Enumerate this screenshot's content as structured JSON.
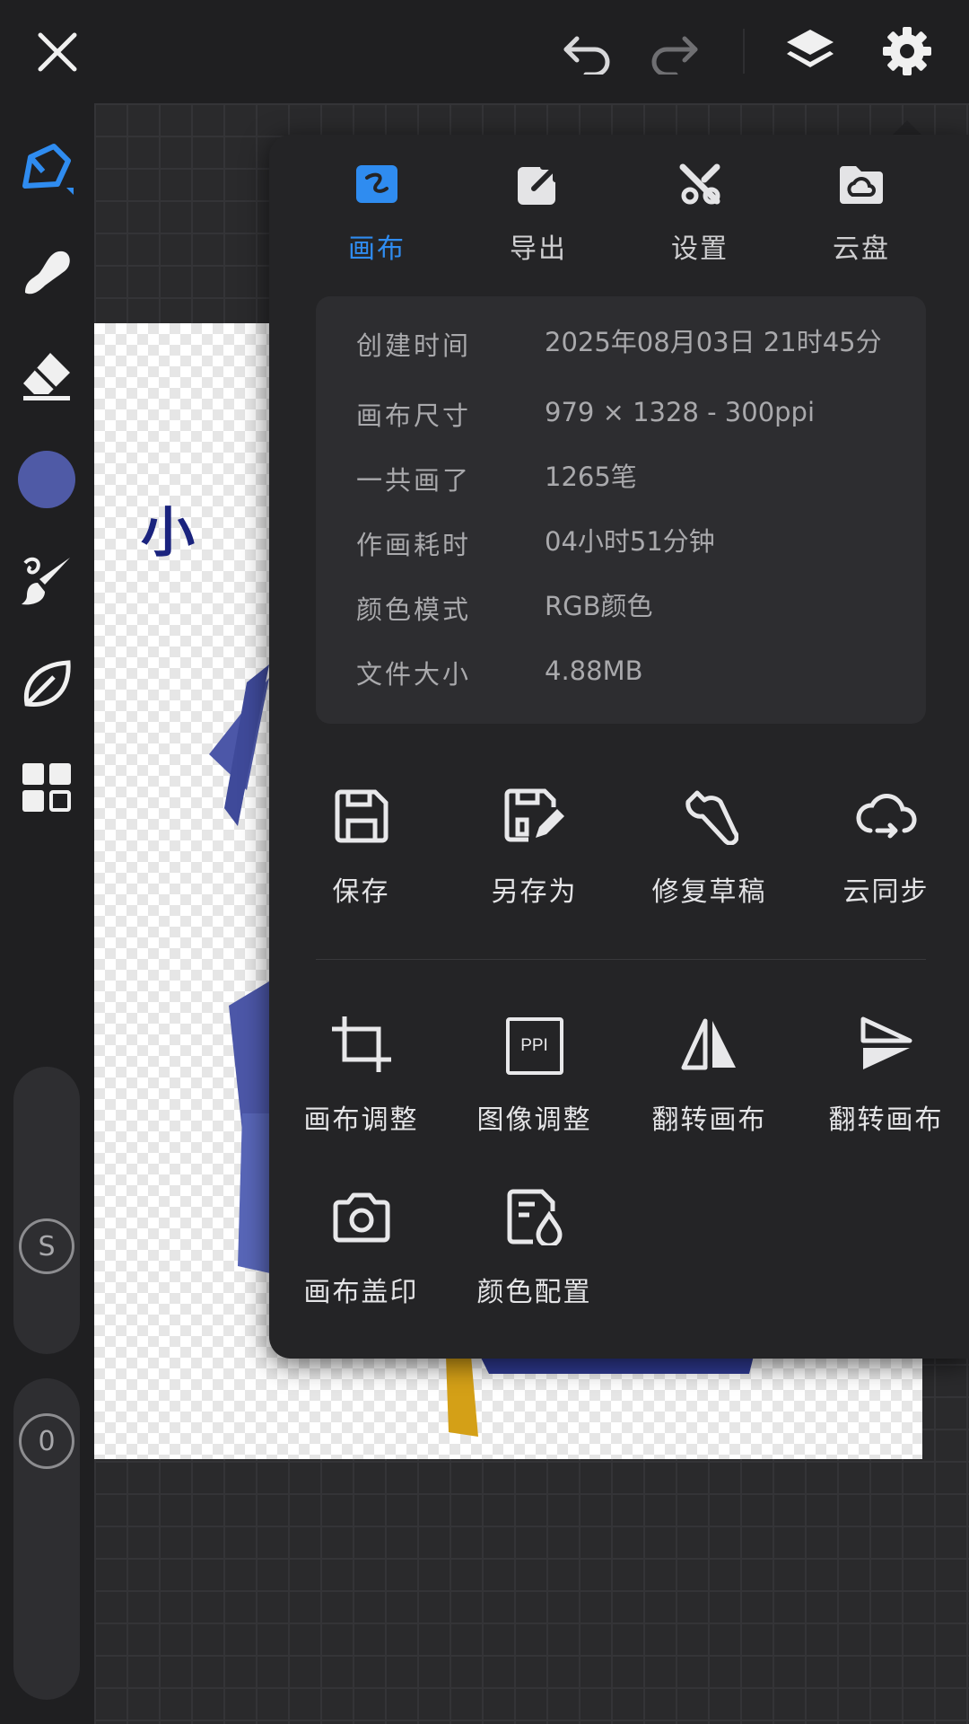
{
  "app": {
    "accent": "#2f8cf0",
    "color_swatch": "#4f5aa6"
  },
  "topbar": {
    "close_icon": "close-icon",
    "undo_icon": "undo-icon",
    "redo_icon": "redo-icon",
    "layers_icon": "layers-icon",
    "settings_icon": "gear-icon"
  },
  "left_tools": [
    {
      "name": "pen-tool",
      "icon": "pen-icon"
    },
    {
      "name": "smudge-tool",
      "icon": "smudge-icon"
    },
    {
      "name": "eraser-tool",
      "icon": "eraser-icon"
    },
    {
      "name": "color-picker",
      "icon": "color-swatch"
    },
    {
      "name": "brush-tool",
      "icon": "brush-icon"
    },
    {
      "name": "leaf-tool",
      "icon": "leaf-icon"
    },
    {
      "name": "grid-tool",
      "icon": "grid-icon"
    }
  ],
  "sliders": {
    "size_label": "S",
    "opacity_label": "0"
  },
  "canvas": {
    "title_text": "小 雪"
  },
  "panel": {
    "tabs": [
      {
        "label": "画布",
        "icon": "canvas-icon",
        "active": true
      },
      {
        "label": "导出",
        "icon": "export-icon",
        "active": false
      },
      {
        "label": "设置",
        "icon": "tools-icon",
        "active": false
      },
      {
        "label": "云盘",
        "icon": "cloud-folder-icon",
        "active": false
      }
    ],
    "info": [
      {
        "key": "创建时间",
        "value": "2025年08月03日 21时45分"
      },
      {
        "key": "画布尺寸",
        "value": "979 × 1328 - 300ppi"
      },
      {
        "key": "一共画了",
        "value": "1265笔"
      },
      {
        "key": "作画耗时",
        "value": "04小时51分钟"
      },
      {
        "key": "颜色模式",
        "value": "RGB颜色"
      },
      {
        "key": "文件大小",
        "value": "4.88MB"
      }
    ],
    "actions_row1": [
      {
        "label": "保存",
        "icon": "save-icon"
      },
      {
        "label": "另存为",
        "icon": "save-as-icon"
      },
      {
        "label": "修复草稿",
        "icon": "wrench-icon"
      },
      {
        "label": "云同步",
        "icon": "cloud-sync-icon"
      }
    ],
    "actions_row2": [
      {
        "label": "画布调整",
        "icon": "crop-icon"
      },
      {
        "label": "图像调整",
        "icon": "ppi-icon",
        "icon_text": "PPI"
      },
      {
        "label": "翻转画布",
        "icon": "flip-horizontal-icon"
      },
      {
        "label": "翻转画布",
        "icon": "flip-vertical-icon"
      }
    ],
    "actions_row3": [
      {
        "label": "画布盖印",
        "icon": "camera-icon"
      },
      {
        "label": "颜色配置",
        "icon": "color-profile-icon"
      }
    ]
  }
}
